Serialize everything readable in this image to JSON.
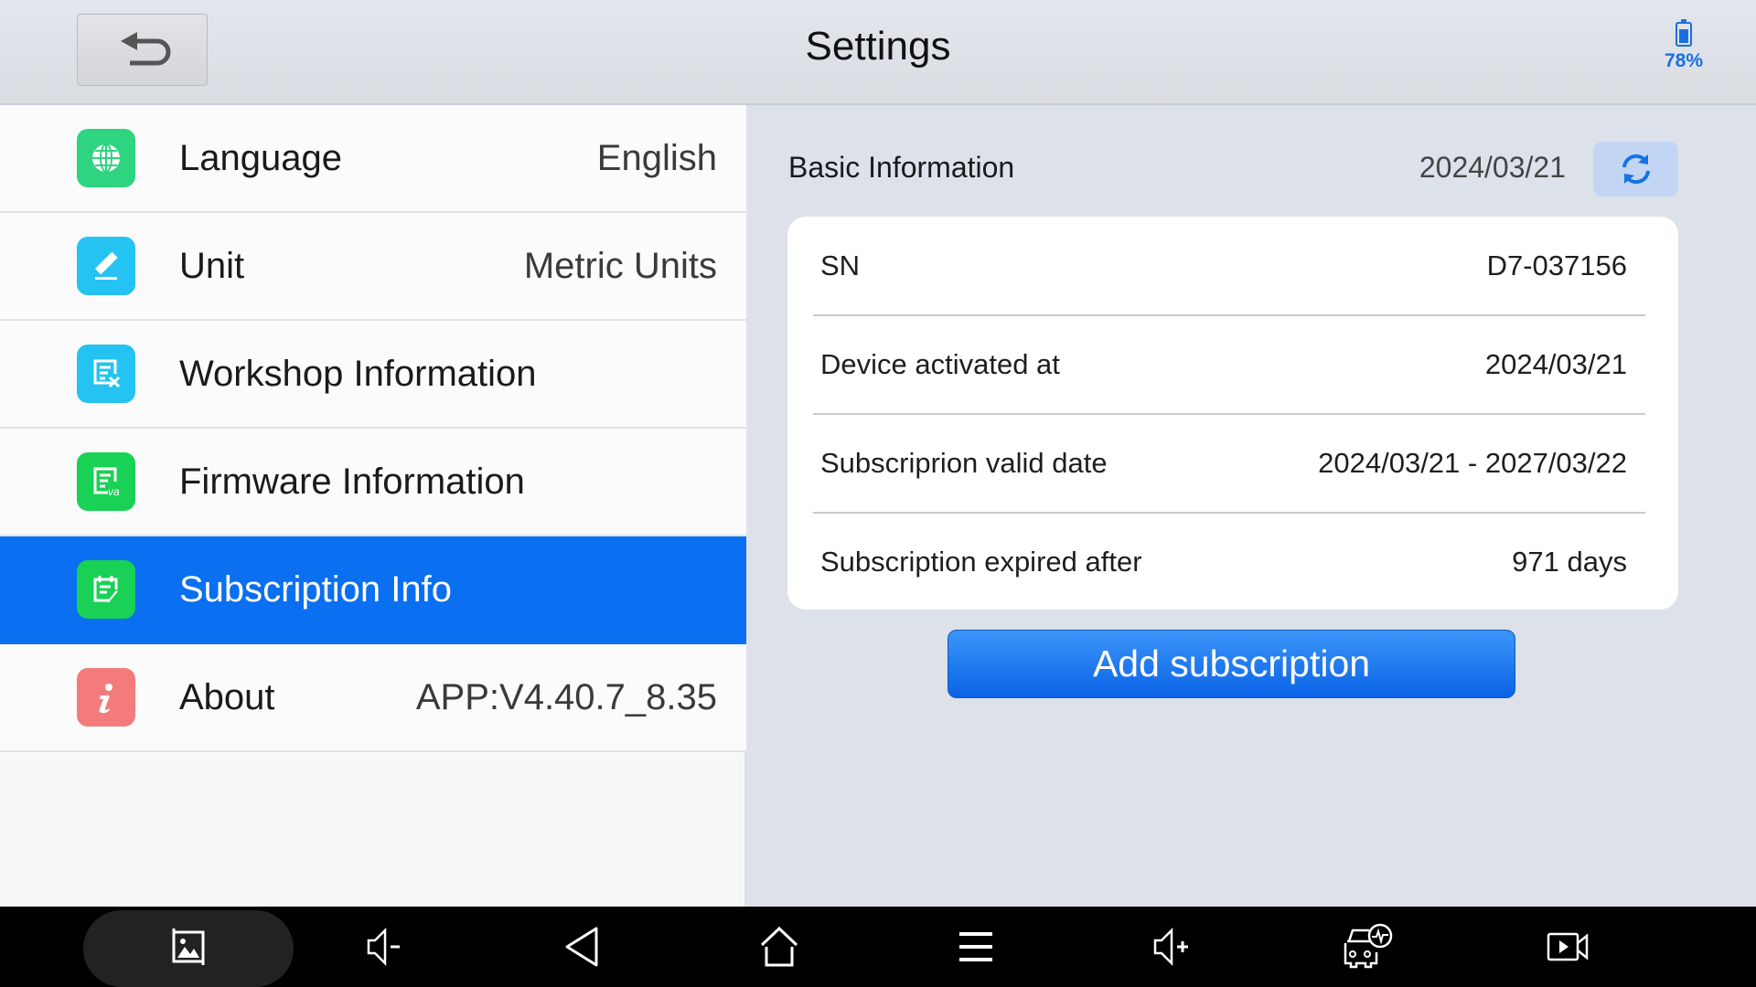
{
  "header": {
    "title": "Settings",
    "back_icon": "back-arrow-icon",
    "battery": {
      "percent_label": "78%",
      "level": 0.78,
      "icon": "battery-icon",
      "color": "#1a6fe0"
    }
  },
  "sidebar": {
    "selected_color": "#0a6ff0",
    "items": [
      {
        "label": "Language",
        "value": "English",
        "icon": "globe-icon",
        "icon_color": "#2ed47f",
        "selected": false
      },
      {
        "label": "Unit",
        "value": "Metric Units",
        "icon": "ruler-icon",
        "icon_color": "#24c3f2",
        "selected": false
      },
      {
        "label": "Workshop Information",
        "value": "",
        "icon": "workshop-doc-icon",
        "icon_color": "#24c3f2",
        "selected": false
      },
      {
        "label": "Firmware Information",
        "value": "",
        "icon": "firmware-doc-icon",
        "icon_color": "#19d155",
        "selected": false
      },
      {
        "label": "Subscription Info",
        "value": "",
        "icon": "subscription-calendar-icon",
        "icon_color": "#19d155",
        "selected": true
      },
      {
        "label": "About",
        "value": "APP:V4.40.7_8.35",
        "icon": "info-icon",
        "icon_color": "#f47b7b",
        "selected": false
      }
    ]
  },
  "basic_info": {
    "title": "Basic Information",
    "date": "2024/03/21",
    "refresh_icon": "refresh-icon",
    "rows": [
      {
        "key": "SN",
        "value": "D7-037156"
      },
      {
        "key": "Device activated at",
        "value": "2024/03/21"
      },
      {
        "key": "Subscriprion valid date",
        "value": "2024/03/21 - 2027/03/22"
      },
      {
        "key": "Subscription expired after",
        "value": "971 days"
      }
    ],
    "add_button": "Add subscription"
  },
  "navbar": {
    "items": [
      {
        "name": "screenshot",
        "icon": "screenshot-icon",
        "active": true
      },
      {
        "name": "volume-down",
        "icon": "volume-down-icon"
      },
      {
        "name": "back",
        "icon": "back-triangle-icon"
      },
      {
        "name": "home",
        "icon": "home-icon"
      },
      {
        "name": "menu",
        "icon": "menu-icon"
      },
      {
        "name": "volume-up",
        "icon": "volume-up-icon"
      },
      {
        "name": "vehicle-diagnostics",
        "icon": "car-diagnostic-icon"
      },
      {
        "name": "screen-record",
        "icon": "screen-record-icon"
      }
    ]
  }
}
